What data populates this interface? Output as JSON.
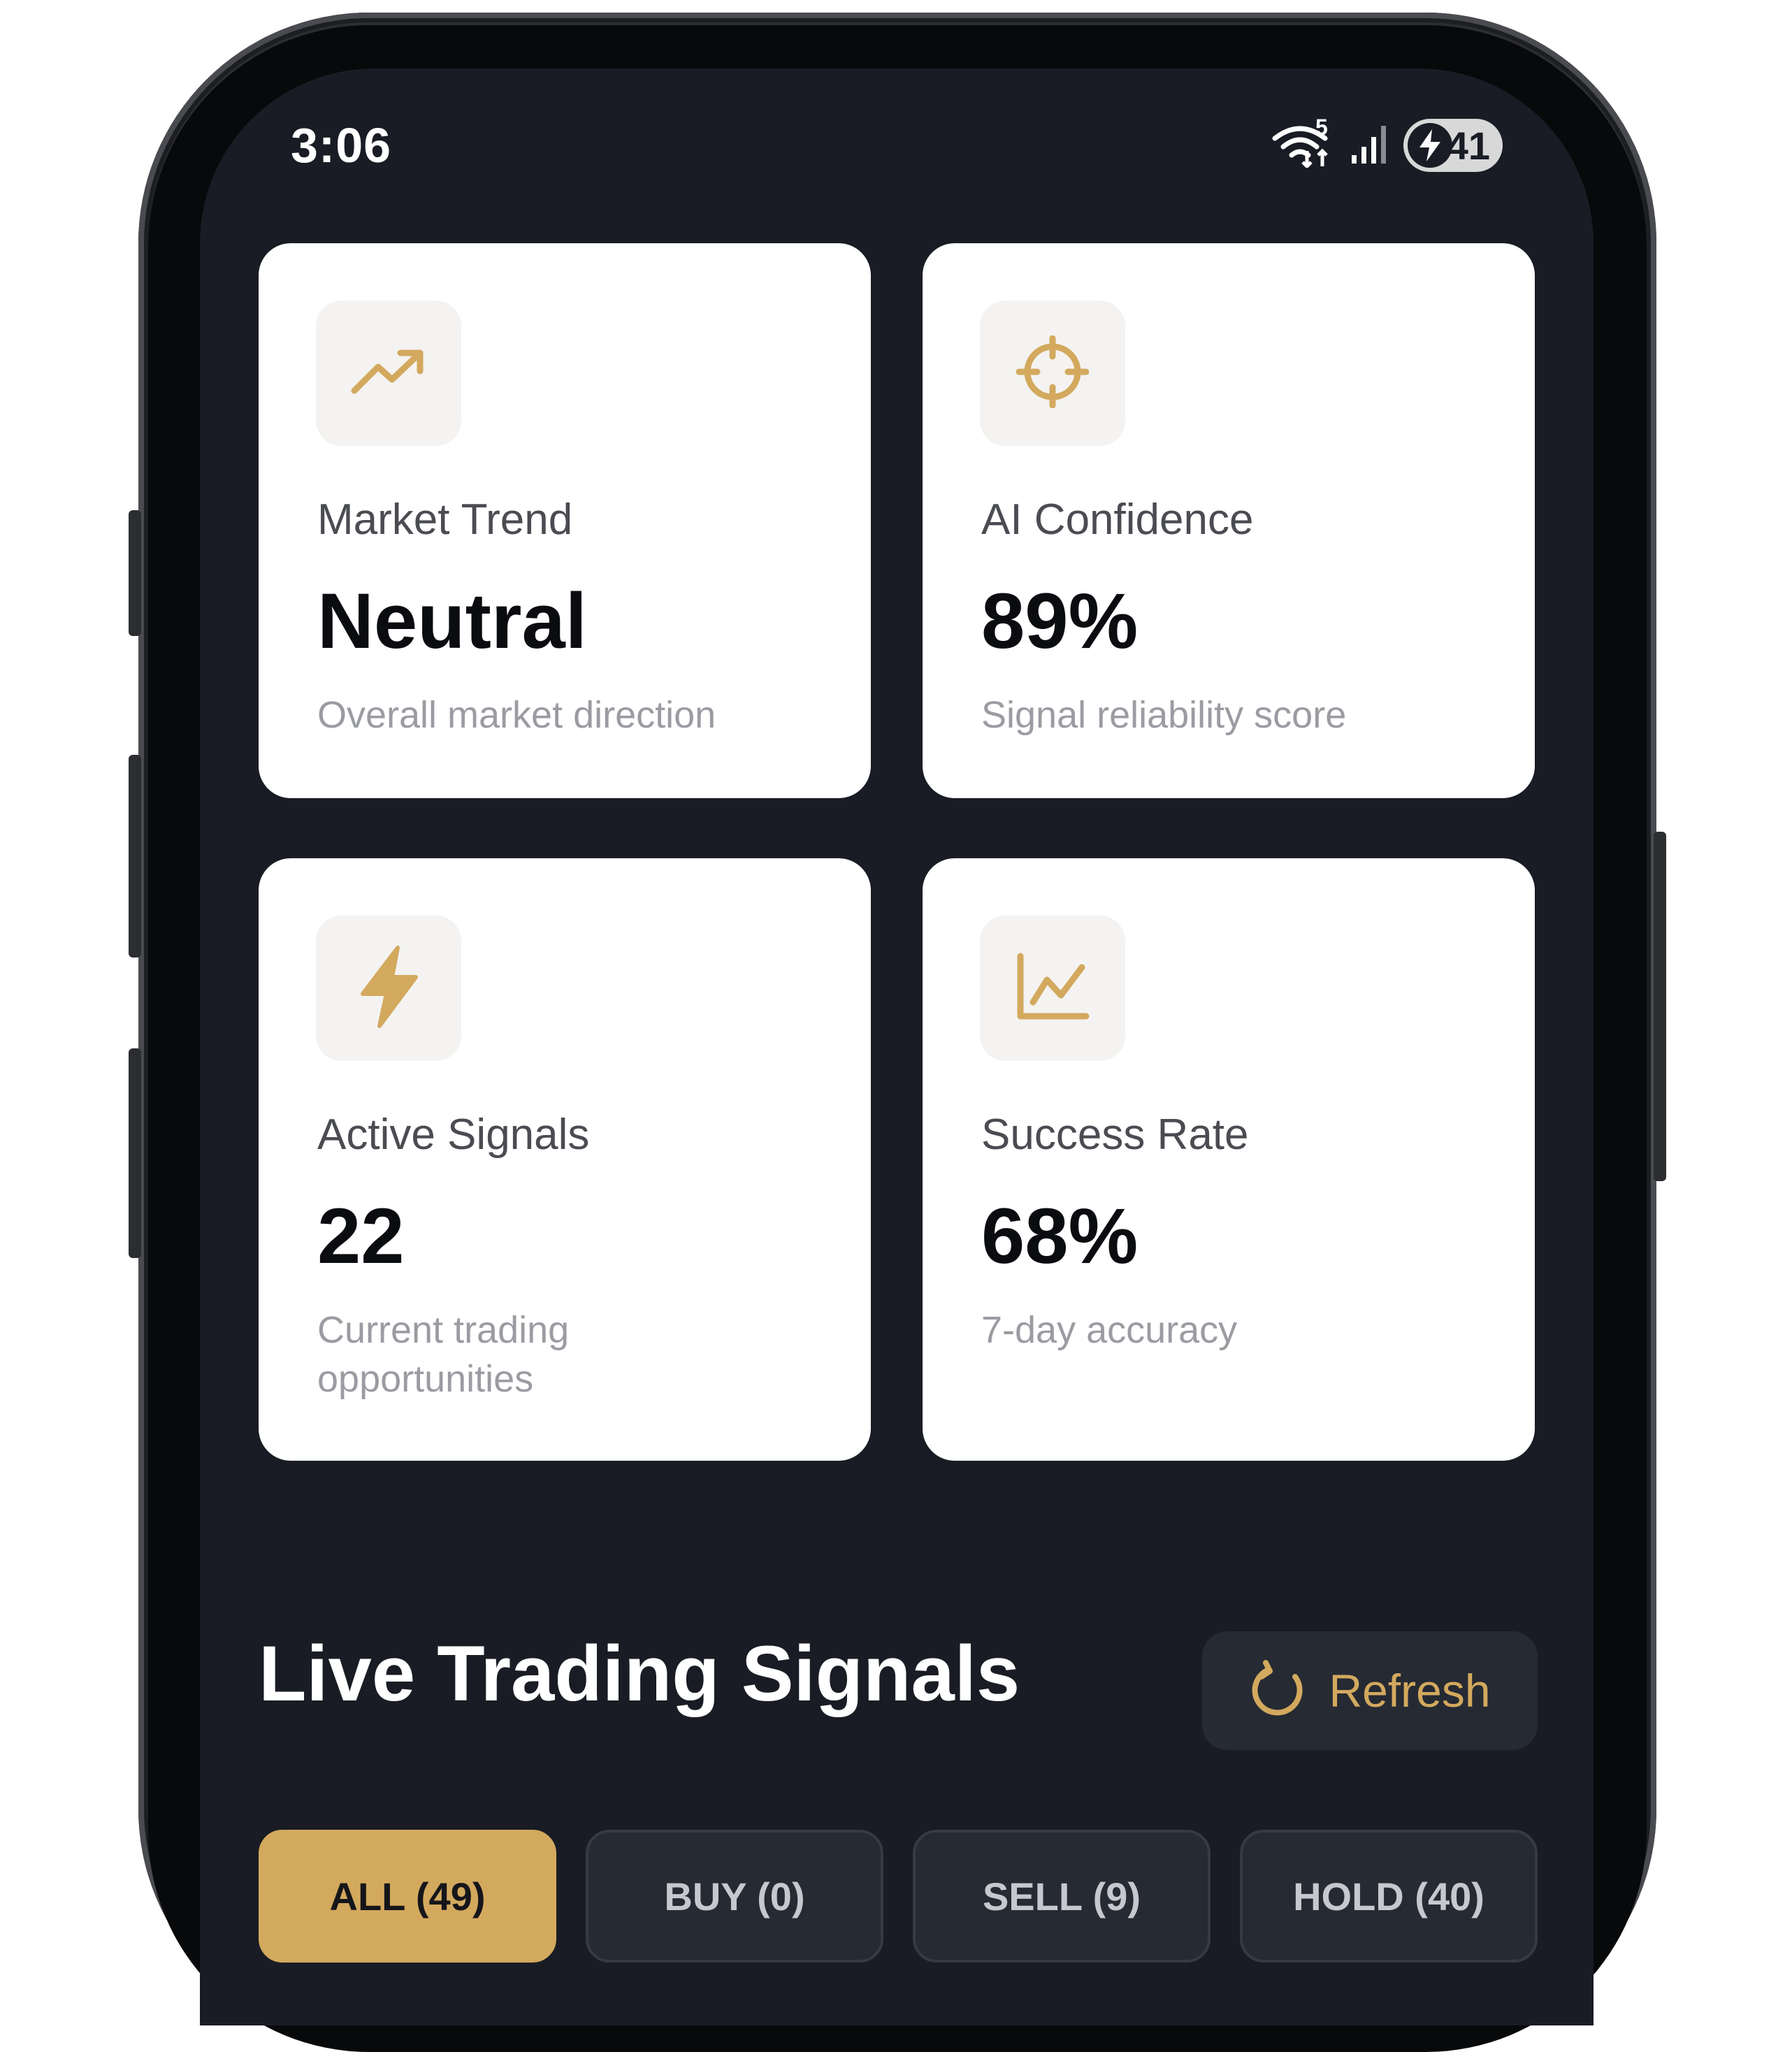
{
  "status_bar": {
    "time": "3:06",
    "network_badge": "5",
    "battery_level": "41",
    "icons": [
      "wifi-icon",
      "signal-icon",
      "battery-charging-icon"
    ]
  },
  "cards": [
    {
      "icon": "trending-up-icon",
      "label": "Market Trend",
      "value": "Neutral",
      "sub": "Overall market direction"
    },
    {
      "icon": "crosshair-icon",
      "label": "AI Confidence",
      "value": "89%",
      "sub": "Signal reliability score"
    },
    {
      "icon": "lightning-icon",
      "label": "Active Signals",
      "value": "22",
      "sub": "Current trading opportunities"
    },
    {
      "icon": "line-chart-icon",
      "label": "Success Rate",
      "value": "68%",
      "sub": "7-day accuracy"
    }
  ],
  "section": {
    "title": "Live Trading Signals",
    "refresh_label": "Refresh"
  },
  "filters": [
    {
      "label": "ALL (49)",
      "active": true
    },
    {
      "label": "BUY (0)",
      "active": false
    },
    {
      "label": "SELL (9)",
      "active": false
    },
    {
      "label": "HOLD (40)",
      "active": false
    }
  ],
  "colors": {
    "accent": "#d3a95e",
    "background": "#191c24",
    "card": "#ffffff",
    "button": "#262a33"
  }
}
